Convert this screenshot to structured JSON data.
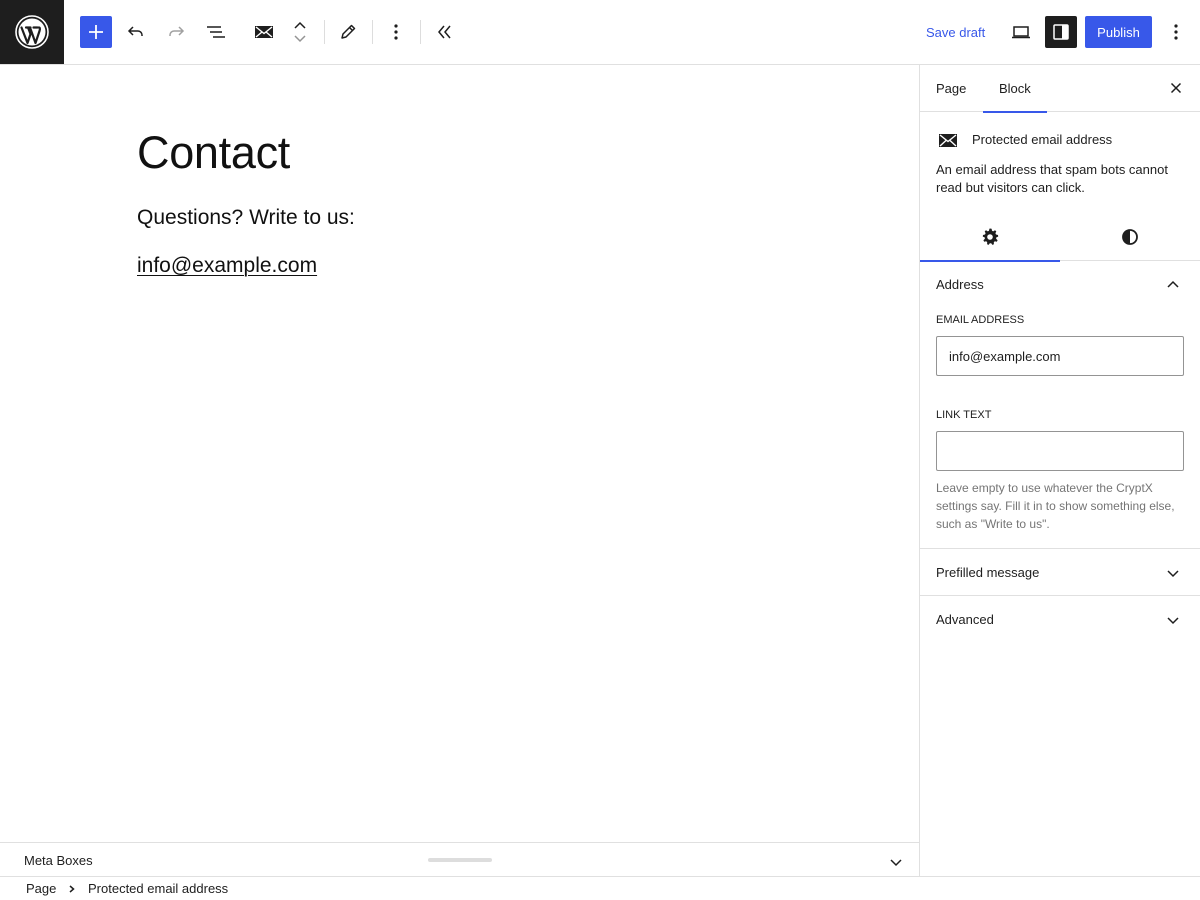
{
  "toolbar": {
    "save_draft_label": "Save draft",
    "publish_label": "Publish"
  },
  "canvas": {
    "title": "Contact",
    "paragraph": "Questions? Write to us:",
    "email_link_text": "info@example.com"
  },
  "sidebar": {
    "tabs": [
      {
        "label": "Page",
        "active": false
      },
      {
        "label": "Block",
        "active": true
      }
    ],
    "block": {
      "name": "Protected email address",
      "description": "An email address that spam bots cannot read but visitors can click."
    },
    "inspector_tabs": [
      {
        "icon": "gear-icon",
        "active": true
      },
      {
        "icon": "contrast-icon",
        "active": false
      }
    ],
    "panels": {
      "address": {
        "title": "Address",
        "expanded": true,
        "email_label": "EMAIL ADDRESS",
        "email_value": "info@example.com",
        "link_text_label": "LINK TEXT",
        "link_text_value": "",
        "help": "Leave empty to use whatever the CryptX settings say. Fill it in to show something else, such as \"Write to us\"."
      },
      "prefilled": {
        "title": "Prefilled message",
        "expanded": false
      },
      "advanced": {
        "title": "Advanced",
        "expanded": false
      }
    }
  },
  "metabox": {
    "title": "Meta Boxes"
  },
  "breadcrumb": [
    "Page",
    "Protected email address"
  ],
  "colors": {
    "accent": "#3858e9",
    "dark": "#1e1e1e",
    "border": "#e0e0e0"
  }
}
